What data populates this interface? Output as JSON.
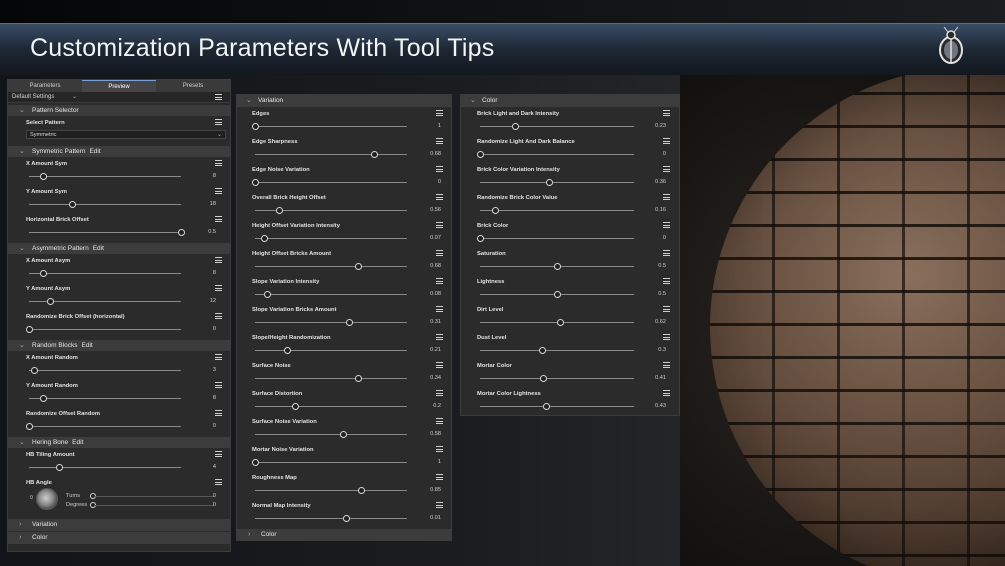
{
  "header": {
    "title": "Customization Parameters With Tool Tips"
  },
  "icons": {
    "logo": "beetle-logo-icon",
    "menu": "hamburger-menu-icon",
    "expand": "chevron-down-icon",
    "collapse": "chevron-right-icon"
  },
  "colors": {
    "accent": "#7aa2d6",
    "header": "#2a3545",
    "panel": "#2b2b2b",
    "section": "#3c3c3c"
  },
  "left_panel": {
    "tabs": [
      {
        "label": "Parameters",
        "active": false
      },
      {
        "label": "Preview",
        "active": true
      },
      {
        "label": "Presets",
        "active": false
      }
    ],
    "settings_label": "Default Settings",
    "pattern_selector": {
      "title": "Pattern Selector",
      "select_label": "Select Pattern",
      "selected": "Symmetric"
    },
    "symmetric": {
      "title": "Symmetric Pattern",
      "edit": "Edit",
      "params": [
        {
          "label": "X Amount Sym",
          "value": "8",
          "fraction": 0.09
        },
        {
          "label": "Y Amount Sym",
          "value": "18",
          "fraction": 0.28
        },
        {
          "label": "Horizontal Brick Offset",
          "value": "0.5",
          "fraction": 1.0
        }
      ]
    },
    "asymmetric": {
      "title": "Asymmetric Pattern",
      "edit": "Edit",
      "params": [
        {
          "label": "X Amount Asym",
          "value": "8",
          "fraction": 0.09
        },
        {
          "label": "Y Amount Asym",
          "value": "12",
          "fraction": 0.14
        },
        {
          "label": "Randomize Brick Offset (horizontal)",
          "value": "0",
          "fraction": 0.0
        }
      ]
    },
    "random_blocks": {
      "title": "Random Blocks",
      "edit": "Edit",
      "params": [
        {
          "label": "X Amount Random",
          "value": "3",
          "fraction": 0.03
        },
        {
          "label": "Y Amount Random",
          "value": "8",
          "fraction": 0.09
        },
        {
          "label": "Randomize Offset Random",
          "value": "0",
          "fraction": 0.0
        }
      ]
    },
    "hering_bone": {
      "title": "Hering Bone",
      "edit": "Edit",
      "tiling": {
        "label": "HB Tiling Amount",
        "value": "4",
        "fraction": 0.2
      },
      "angle": {
        "label": "HB Angle",
        "zero": "0",
        "turns_label": "Turns",
        "turns_value": "0",
        "degrees_label": "Degrees",
        "degrees_value": "0"
      }
    },
    "collapsed": [
      "Variation",
      "Color"
    ]
  },
  "variation_panel": {
    "title": "Variation",
    "params": [
      {
        "label": "Edges",
        "value": "1",
        "fraction": 0.0
      },
      {
        "label": "Edge Sharpness",
        "value": "0.68",
        "fraction": 0.78
      },
      {
        "label": "Edge Noise Variation",
        "value": "0",
        "fraction": 0.0
      },
      {
        "label": "Overall Brick Height Offset",
        "value": "0.56",
        "fraction": 0.16
      },
      {
        "label": "Height Offset Variation Intensity",
        "value": "0.07",
        "fraction": 0.06
      },
      {
        "label": "Height Offset Bricks Amount",
        "value": "0.68",
        "fraction": 0.68
      },
      {
        "label": "Slope Variation Intensity",
        "value": "0.08",
        "fraction": 0.08
      },
      {
        "label": "Slope Variation Bricks Amount",
        "value": "0.31",
        "fraction": 0.62
      },
      {
        "label": "Slope/Height Randomization",
        "value": "0.21",
        "fraction": 0.21
      },
      {
        "label": "Surface Noise",
        "value": "0.34",
        "fraction": 0.68
      },
      {
        "label": "Surface Distortion",
        "value": "0.2",
        "fraction": 0.26
      },
      {
        "label": "Surface Noise Variation",
        "value": "0.58",
        "fraction": 0.58
      },
      {
        "label": "Mortar Noise Variation",
        "value": "1",
        "fraction": 0.0
      },
      {
        "label": "Roughness Map",
        "value": "0.85",
        "fraction": 0.7
      },
      {
        "label": "Normal Map Intensity",
        "value": "0.01",
        "fraction": 0.6
      }
    ],
    "footer": "Color"
  },
  "color_panel": {
    "title": "Color",
    "params": [
      {
        "label": "Brick Light and Dark Intensity",
        "value": "0.23",
        "fraction": 0.23
      },
      {
        "label": "Randomize Light And Dark Balance",
        "value": "0",
        "fraction": 0.0
      },
      {
        "label": "Brick Color Variation Intensity",
        "value": "0.36",
        "fraction": 0.45
      },
      {
        "label": "Randomize Brick Color Value",
        "value": "0.16",
        "fraction": 0.1
      },
      {
        "label": "Brick Color",
        "value": "0",
        "fraction": 0.0
      },
      {
        "label": "Saturation",
        "value": "0.5",
        "fraction": 0.5
      },
      {
        "label": "Lightness",
        "value": "0.5",
        "fraction": 0.5
      },
      {
        "label": "Dirt Level",
        "value": "0.62",
        "fraction": 0.52
      },
      {
        "label": "Dust Level",
        "value": "0.3",
        "fraction": 0.4
      },
      {
        "label": "Mortar Color",
        "value": "0.41",
        "fraction": 0.41
      },
      {
        "label": "Mortar Color Lightness",
        "value": "0.43",
        "fraction": 0.43
      }
    ]
  }
}
